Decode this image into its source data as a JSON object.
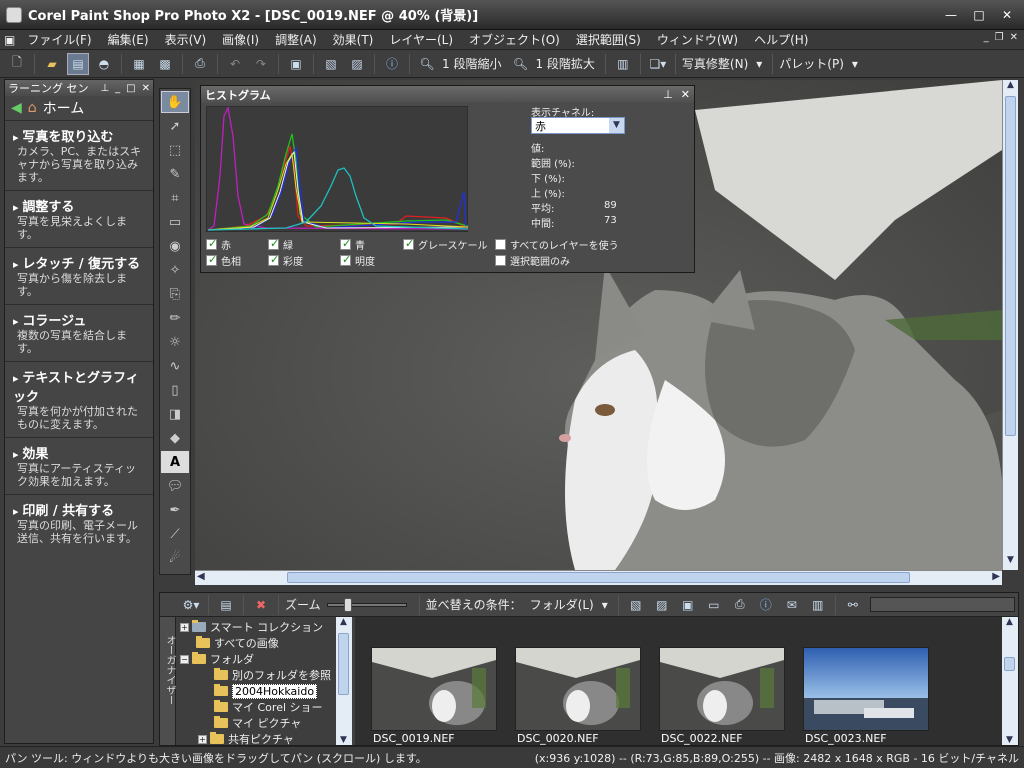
{
  "window": {
    "title": "Corel Paint Shop Pro Photo X2 - [DSC_0019.NEF @ 40% (背景)]"
  },
  "menu": [
    "ファイル(F)",
    "編集(E)",
    "表示(V)",
    "画像(I)",
    "調整(A)",
    "効果(T)",
    "レイヤー(L)",
    "オブジェクト(O)",
    "選択範囲(S)",
    "ウィンドウ(W)",
    "ヘルプ(H)"
  ],
  "toolbar": {
    "zoom_out": "1 段階縮小",
    "zoom_in": "1 段階拡大",
    "photo_fix": "写真修整(N)",
    "palette": "パレット(P)"
  },
  "learning": {
    "title": "ラーニング セン",
    "home": "ホーム",
    "items": [
      {
        "title": "写真を取り込む",
        "desc": "カメラ、PC、またはスキャナから写真を取り込みます。"
      },
      {
        "title": "調整する",
        "desc": "写真を見栄えよくします。"
      },
      {
        "title": "レタッチ / 復元する",
        "desc": "写真から傷を除去します。"
      },
      {
        "title": "コラージュ",
        "desc": "複数の写真を結合します。"
      },
      {
        "title": "テキストとグラフィック",
        "desc": "写真を何かが付加されたものに変えます。"
      },
      {
        "title": "効果",
        "desc": "写真にアーティスティック効果を加えます。"
      },
      {
        "title": "印刷 / 共有する",
        "desc": "写真の印刷、電子メール送信、共有を行います。"
      }
    ]
  },
  "histogram": {
    "title": "ヒストグラム",
    "channel_label": "表示チャネル:",
    "channel_value": "赤",
    "stats": {
      "value_label": "値:",
      "range_label": "範囲 (%):",
      "low_label": "下 (%):",
      "high_label": "上 (%):",
      "mean_label": "平均:",
      "mean_value": "89",
      "median_label": "中間:",
      "median_value": "73"
    },
    "checks": [
      {
        "label": "赤",
        "on": true
      },
      {
        "label": "緑",
        "on": true
      },
      {
        "label": "青",
        "on": true
      },
      {
        "label": "グレースケール",
        "on": true
      },
      {
        "label": "すべてのレイヤーを使う",
        "on": false
      },
      {
        "label": "色相",
        "on": true
      },
      {
        "label": "彩度",
        "on": true
      },
      {
        "label": "明度",
        "on": true
      },
      {
        "label": "選択範囲のみ",
        "on": false
      }
    ],
    "colors": {
      "red": "#e02020",
      "green": "#20c020",
      "blue": "#2030e0",
      "gray": "#f0f0f0",
      "hue": "#c020c0",
      "saturation": "#e0e020",
      "lightness": "#20c0c0"
    }
  },
  "organizer": {
    "side_label": "オーガナイザー",
    "zoom_label": "ズーム",
    "sort_label": "並べ替えの条件：",
    "sort_value": "フォルダ(L)",
    "tree": [
      "スマート コレクション",
      "すべての画像",
      "フォルダ",
      "別のフォルダを参照",
      "2004Hokkaido",
      "マイ Corel ショー",
      "マイ ピクチャ",
      "共有ピクチャ"
    ],
    "thumbs": [
      "DSC_0019.NEF",
      "DSC_0020.NEF",
      "DSC_0022.NEF",
      "DSC_0023.NEF"
    ]
  },
  "status": {
    "left": "パン ツール: ウィンドウよりも大きい画像をドラッグしてパン (スクロール) します。",
    "right": "(x:936 y:1028) -- (R:73,G:85,B:89,O:255) -- 画像: 2482 x 1648 x RGB - 16 ビット/チャネル"
  }
}
